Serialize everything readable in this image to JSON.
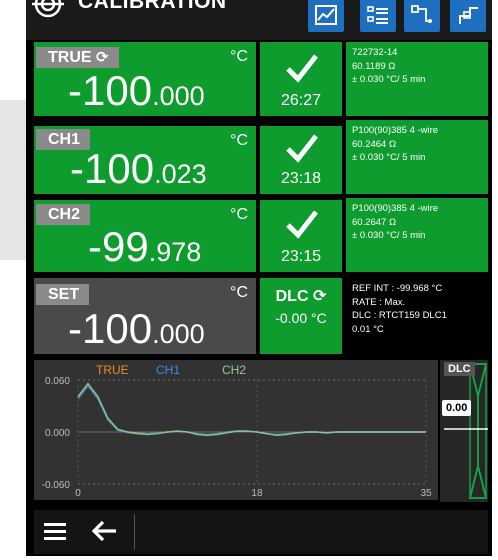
{
  "header": {
    "title": "CALIBRATION",
    "buttons": [
      "chart-icon",
      "list-icon",
      "connection-icon",
      "probe-icon"
    ]
  },
  "channels": [
    {
      "label": "TRUE",
      "has_sync_icon": true,
      "unit": "°C",
      "value_int": "-100",
      "value_dec": ".000",
      "status": "check",
      "time": "26:27",
      "info": [
        "722732-14",
        "60.1189 Ω",
        "± 0.030 °C/ 5 min"
      ]
    },
    {
      "label": "CH1",
      "has_sync_icon": false,
      "unit": "°C",
      "value_int": "-100",
      "value_dec": ".023",
      "status": "check",
      "time": "23:18",
      "info": [
        "P100(90)385 4 -wire",
        "60.2464 Ω",
        "± 0.030 °C/ 5 min"
      ]
    },
    {
      "label": "CH2",
      "has_sync_icon": false,
      "unit": "°C",
      "value_int": "-99",
      "value_dec": ".978",
      "status": "check",
      "time": "23:15",
      "info": [
        "P100(90)385 4 -wire",
        "60.2647 Ω",
        "± 0.030 °C/ 5 min"
      ]
    }
  ],
  "set": {
    "label": "SET",
    "unit": "°C",
    "value_int": "-100",
    "value_dec": ".000",
    "dlc_label": "DLC",
    "dlc_value": "-0.00 °C",
    "info": [
      "REF INT : -99.968 °C",
      "RATE : Max.",
      "DLC : RTCT159 DLC1",
      "0.01 °C"
    ]
  },
  "chart_data": {
    "type": "line",
    "legend": [
      "TRUE",
      "CH1",
      "CH2"
    ],
    "colors": {
      "TRUE": "#f08a24",
      "CH1": "#3a8ee6",
      "CH2": "#8fcf8f"
    },
    "y_ticks": [
      "0.060",
      "0.000",
      "-0.060"
    ],
    "x_ticks": [
      "0",
      "18",
      "35"
    ],
    "ylim": [
      -0.06,
      0.06
    ],
    "xlim": [
      0,
      35
    ],
    "series": [
      {
        "name": "TRUE",
        "x": [
          0,
          1,
          2,
          3,
          4,
          5,
          6,
          7,
          8,
          9,
          10,
          11,
          12,
          13,
          14,
          15,
          16,
          17,
          18,
          19,
          20,
          21,
          22,
          23,
          24,
          25,
          26,
          27,
          28,
          29,
          30,
          31,
          32,
          33,
          34,
          35
        ],
        "values": [
          0.04,
          0.055,
          0.04,
          0.015,
          0.003,
          0.0,
          -0.001,
          -0.002,
          -0.001,
          0.0,
          0.001,
          0.0,
          -0.002,
          -0.003,
          -0.002,
          0.0,
          0.001,
          0.001,
          0.0,
          -0.002,
          -0.003,
          -0.002,
          -0.001,
          0.0,
          0.0,
          -0.001,
          0.0,
          0.0,
          0.0,
          0.0,
          0.0,
          0.0,
          0.0,
          0.0,
          0.0,
          0.0
        ]
      },
      {
        "name": "CH1",
        "x": [
          0,
          1,
          2,
          3,
          4,
          5,
          6,
          7,
          8,
          9,
          10,
          11,
          12,
          13,
          14,
          15,
          16,
          17,
          18,
          19,
          20,
          21,
          22,
          23,
          24,
          25,
          26,
          27,
          28,
          29,
          30,
          31,
          32,
          33,
          34,
          35
        ],
        "values": [
          0.038,
          0.053,
          0.038,
          0.014,
          0.002,
          -0.001,
          -0.002,
          -0.002,
          -0.001,
          0.0,
          0.001,
          0.0,
          -0.002,
          -0.003,
          -0.002,
          0.0,
          0.001,
          0.001,
          0.0,
          -0.002,
          -0.003,
          -0.002,
          -0.001,
          0.0,
          0.0,
          -0.001,
          0.0,
          0.0,
          0.0,
          0.0,
          0.0,
          0.0,
          0.0,
          0.0,
          0.0,
          0.0
        ]
      },
      {
        "name": "CH2",
        "x": [
          0,
          1,
          2,
          3,
          4,
          5,
          6,
          7,
          8,
          9,
          10,
          11,
          12,
          13,
          14,
          15,
          16,
          17,
          18,
          19,
          20,
          21,
          22,
          23,
          24,
          25,
          26,
          27,
          28,
          29,
          30,
          31,
          32,
          33,
          34,
          35
        ],
        "values": [
          0.041,
          0.056,
          0.041,
          0.016,
          0.003,
          0.0,
          -0.002,
          -0.003,
          -0.002,
          0.0,
          0.001,
          0.0,
          -0.003,
          -0.004,
          -0.003,
          -0.001,
          0.001,
          0.001,
          0.0,
          -0.002,
          -0.004,
          -0.003,
          -0.001,
          0.0,
          0.0,
          -0.001,
          0.0,
          0.0,
          0.0,
          0.0,
          0.0,
          0.0,
          0.0,
          0.0,
          0.0,
          0.0
        ]
      }
    ]
  },
  "dlc_panel": {
    "label": "DLC",
    "value": "0.00"
  },
  "footer": {
    "menu_icon": "menu-icon",
    "back_icon": "back-arrow-icon"
  }
}
